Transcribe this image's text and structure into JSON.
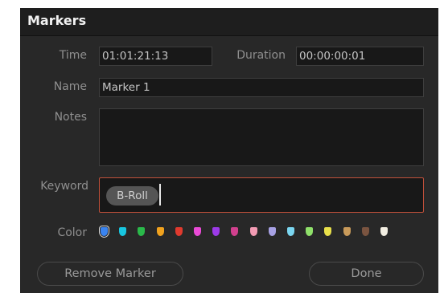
{
  "dialog": {
    "title": "Markers"
  },
  "time": {
    "label": "Time",
    "value": "01:01:21:13"
  },
  "duration": {
    "label": "Duration",
    "value": "00:00:00:01"
  },
  "name": {
    "label": "Name",
    "value": "Marker 1"
  },
  "notes": {
    "label": "Notes",
    "value": ""
  },
  "keyword": {
    "label": "Keyword",
    "chip": "B-Roll"
  },
  "color": {
    "label": "Color",
    "selected": "blue",
    "swatches": [
      {
        "name": "blue",
        "hex": "#3a84f0"
      },
      {
        "name": "cyan",
        "hex": "#18c6e0"
      },
      {
        "name": "green",
        "hex": "#2ab94a"
      },
      {
        "name": "yellow",
        "hex": "#f0a21e"
      },
      {
        "name": "red",
        "hex": "#e03a2e"
      },
      {
        "name": "pink",
        "hex": "#e94ad6"
      },
      {
        "name": "purple",
        "hex": "#9c3ae8"
      },
      {
        "name": "fuchsia",
        "hex": "#d1408e"
      },
      {
        "name": "rose",
        "hex": "#f39cb4"
      },
      {
        "name": "lavender",
        "hex": "#a7a1e4"
      },
      {
        "name": "sky",
        "hex": "#7bd6f0"
      },
      {
        "name": "mint",
        "hex": "#8fe06a"
      },
      {
        "name": "lemon",
        "hex": "#e8e04a"
      },
      {
        "name": "sand",
        "hex": "#c89a5a"
      },
      {
        "name": "cocoa",
        "hex": "#7a5440"
      },
      {
        "name": "cream",
        "hex": "#f2eee2"
      }
    ]
  },
  "buttons": {
    "remove_label": "Remove Marker",
    "done_label": "Done"
  }
}
